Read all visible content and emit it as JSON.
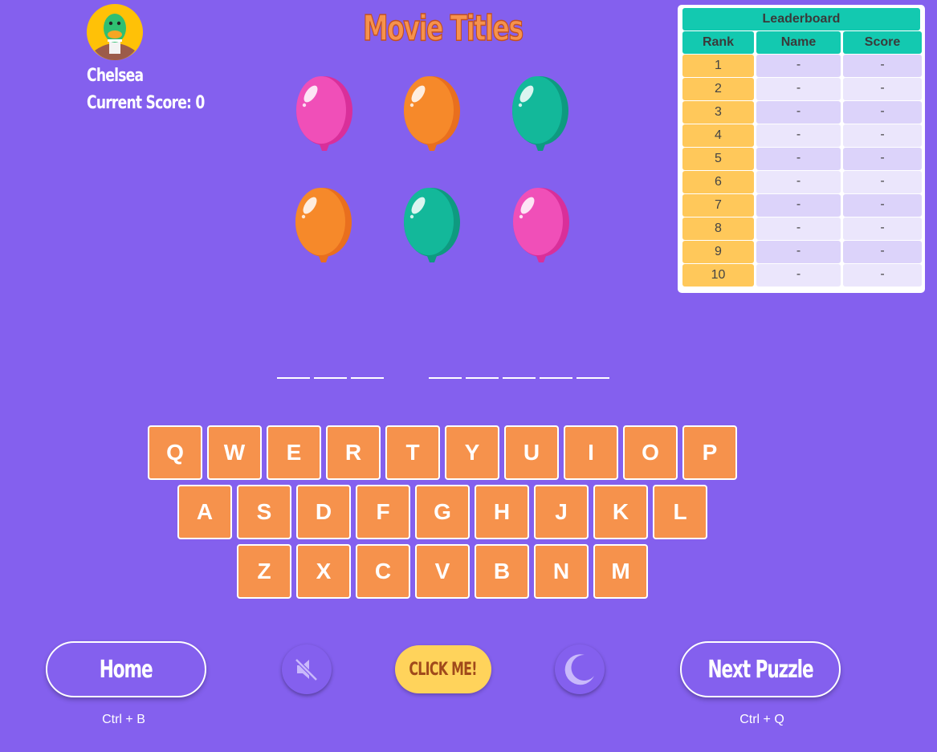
{
  "player": {
    "name": "Chelsea",
    "score_text": "Current Score: 0",
    "avatar_icon": "duck-avatar-icon"
  },
  "title": "Movie Titles",
  "balloons": [
    {
      "color": "pink"
    },
    {
      "color": "orange"
    },
    {
      "color": "teal"
    },
    {
      "color": "orange"
    },
    {
      "color": "teal"
    },
    {
      "color": "pink"
    }
  ],
  "leaderboard": {
    "title": "Leaderboard",
    "headers": {
      "rank": "Rank",
      "name": "Name",
      "score": "Score"
    },
    "rows": [
      {
        "rank": "1",
        "name": "-",
        "score": "-"
      },
      {
        "rank": "2",
        "name": "-",
        "score": "-"
      },
      {
        "rank": "3",
        "name": "-",
        "score": "-"
      },
      {
        "rank": "4",
        "name": "-",
        "score": "-"
      },
      {
        "rank": "5",
        "name": "-",
        "score": "-"
      },
      {
        "rank": "6",
        "name": "-",
        "score": "-"
      },
      {
        "rank": "7",
        "name": "-",
        "score": "-"
      },
      {
        "rank": "8",
        "name": "-",
        "score": "-"
      },
      {
        "rank": "9",
        "name": "-",
        "score": "-"
      },
      {
        "rank": "10",
        "name": "-",
        "score": "-"
      }
    ]
  },
  "puzzle": {
    "words": [
      3,
      5
    ]
  },
  "keyboard": {
    "rows": [
      [
        "Q",
        "W",
        "E",
        "R",
        "T",
        "Y",
        "U",
        "I",
        "O",
        "P"
      ],
      [
        "A",
        "S",
        "D",
        "F",
        "G",
        "H",
        "J",
        "K",
        "L"
      ],
      [
        "Z",
        "X",
        "C",
        "V",
        "B",
        "N",
        "M"
      ]
    ]
  },
  "controls": {
    "home_label": "Home",
    "home_shortcut": "Ctrl + B",
    "mute_icon": "speaker-muted-icon",
    "click_me_label": "CLICK ME!",
    "theme_icon": "moon-icon",
    "next_label": "Next Puzzle",
    "next_shortcut": "Ctrl + Q"
  },
  "colors": {
    "background": "#8460ee",
    "key": "#f6924c",
    "leaderboard_header": "#13c9b0",
    "rank_cell": "#ffc85a",
    "click_me": "#ffd35b",
    "balloon_pink": "#f04fb8",
    "balloon_orange": "#f6892a",
    "balloon_teal": "#13b89a"
  }
}
